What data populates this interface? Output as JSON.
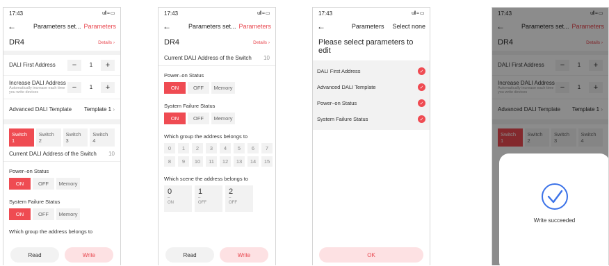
{
  "status": {
    "time": "17:43",
    "icons": "ull ≈ ▭"
  },
  "screen1": {
    "nav": {
      "back": "←",
      "title": "Parameters set...",
      "action": "Parameters"
    },
    "device": {
      "name": "DR4",
      "details": "Details ›"
    },
    "dali_first_address": {
      "label": "DALI First Address",
      "minus": "−",
      "value": "1",
      "plus": "+"
    },
    "increase_address": {
      "label": "Increase DALI Address",
      "sub": "Automatically increase each time you write devices",
      "minus": "−",
      "value": "1",
      "plus": "+"
    },
    "template": {
      "label": "Advanced DALI Template",
      "value": "Template 1",
      "chev": "›"
    },
    "tabs": [
      "Switch 1",
      "Switch 2",
      "Switch 3",
      "Switch 4"
    ],
    "current_address": {
      "label": "Current DALI Address of the Switch",
      "value": "10"
    },
    "power_on": {
      "label": "Power–on Status",
      "options": [
        "ON",
        "OFF",
        "Memory"
      ]
    },
    "system_failure": {
      "label": "System Failure Status",
      "options": [
        "ON",
        "OFF",
        "Memory"
      ]
    },
    "group_cut": "Which group the address belongs to",
    "read": "Read",
    "write": "Write"
  },
  "screen2": {
    "nav": {
      "back": "←",
      "title": "Parameters set...",
      "action": "Parameters"
    },
    "device": {
      "name": "DR4",
      "details": "Details ›"
    },
    "current_address": {
      "label": "Current DALI Address of the Switch",
      "value": "10"
    },
    "power_on": {
      "label": "Power–on Status",
      "options": [
        "ON",
        "OFF",
        "Memory"
      ]
    },
    "system_failure": {
      "label": "System Failure Status",
      "options": [
        "ON",
        "OFF",
        "Memory"
      ]
    },
    "group": {
      "label": "Which group the address belongs to",
      "numbers": [
        "0",
        "1",
        "2",
        "3",
        "4",
        "5",
        "6",
        "7",
        "8",
        "9",
        "10",
        "11",
        "12",
        "13",
        "14",
        "15"
      ]
    },
    "scene": {
      "label": "Which scene the address belongs to",
      "items": [
        {
          "n": "0",
          "dash": "–",
          "state": "ON"
        },
        {
          "n": "1",
          "dash": "–",
          "state": "OFF"
        },
        {
          "n": "2",
          "dash": "–",
          "state": "OFF"
        }
      ]
    },
    "read": "Read",
    "write": "Write"
  },
  "screen3": {
    "nav": {
      "back": "←",
      "title": "Parameters",
      "action": "Select none"
    },
    "heading": "Please select parameters to edit",
    "items": [
      "DALI First Address",
      "Advanced DALI Template",
      "Power–on Status",
      "System Failure Status"
    ],
    "check": "✓",
    "ok": "OK"
  },
  "screen4": {
    "nav": {
      "back": "←",
      "title": "Parameters set...",
      "action": "Parameters"
    },
    "device": {
      "name": "DR4",
      "details": "Details ›"
    },
    "dali_first_address": {
      "label": "DALI First Address",
      "minus": "−",
      "value": "1",
      "plus": "+"
    },
    "increase_address": {
      "label": "Increase DALI Address",
      "sub": "Automatically increase each time you write devices",
      "minus": "−",
      "value": "1",
      "plus": "+"
    },
    "template": {
      "label": "Advanced DALI Template",
      "value": "Template 1",
      "chev": "›"
    },
    "tabs": [
      "Switch 1",
      "Switch 2",
      "Switch 3",
      "Switch 4"
    ],
    "dialog": {
      "message": "Write succeeded"
    }
  }
}
